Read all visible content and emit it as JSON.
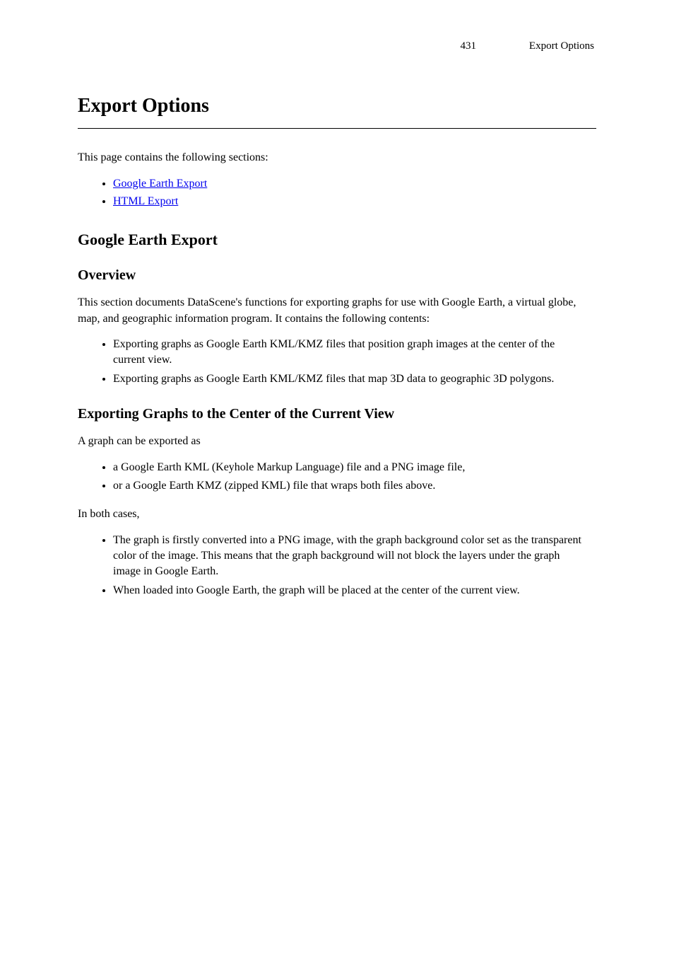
{
  "header": {
    "page_number": "431",
    "page_title": "Export Options"
  },
  "chapter": {
    "title": "Export Options"
  },
  "intro": {
    "text": "This page contains the following sections:",
    "links": [
      {
        "label": "Google Earth Export"
      },
      {
        "label": "HTML Export"
      }
    ]
  },
  "google_section": {
    "heading": "Google Earth Export",
    "overview_heading": "Overview",
    "overview_paragraph": "This section documents DataScene's functions for exporting graphs for use with Google Earth, a virtual globe, map, and geographic information program. It contains the following contents:",
    "overview_bullets": [
      "Exporting graphs as Google Earth KML/KMZ files that position graph images at the center of the current view.",
      "Exporting graphs as Google Earth KML/KMZ files that map 3D data to geographic 3D polygons."
    ],
    "center_heading": "Exporting Graphs to the Center of the Current View",
    "center_intro": "A graph can be exported as",
    "center_bullets_1": [
      "a Google Earth KML (Keyhole Markup Language) file and a PNG image file,",
      "or a Google Earth KMZ (zipped KML) file that wraps both files above."
    ],
    "center_after_1": "In both cases,",
    "center_bullets_2": [
      "The graph is firstly converted into a PNG image, with the graph background color set as the transparent color of the image. This means that the graph background will not block the layers under the graph image in Google Earth.",
      "When loaded into Google Earth, the graph will be placed at the center of the current view."
    ]
  }
}
